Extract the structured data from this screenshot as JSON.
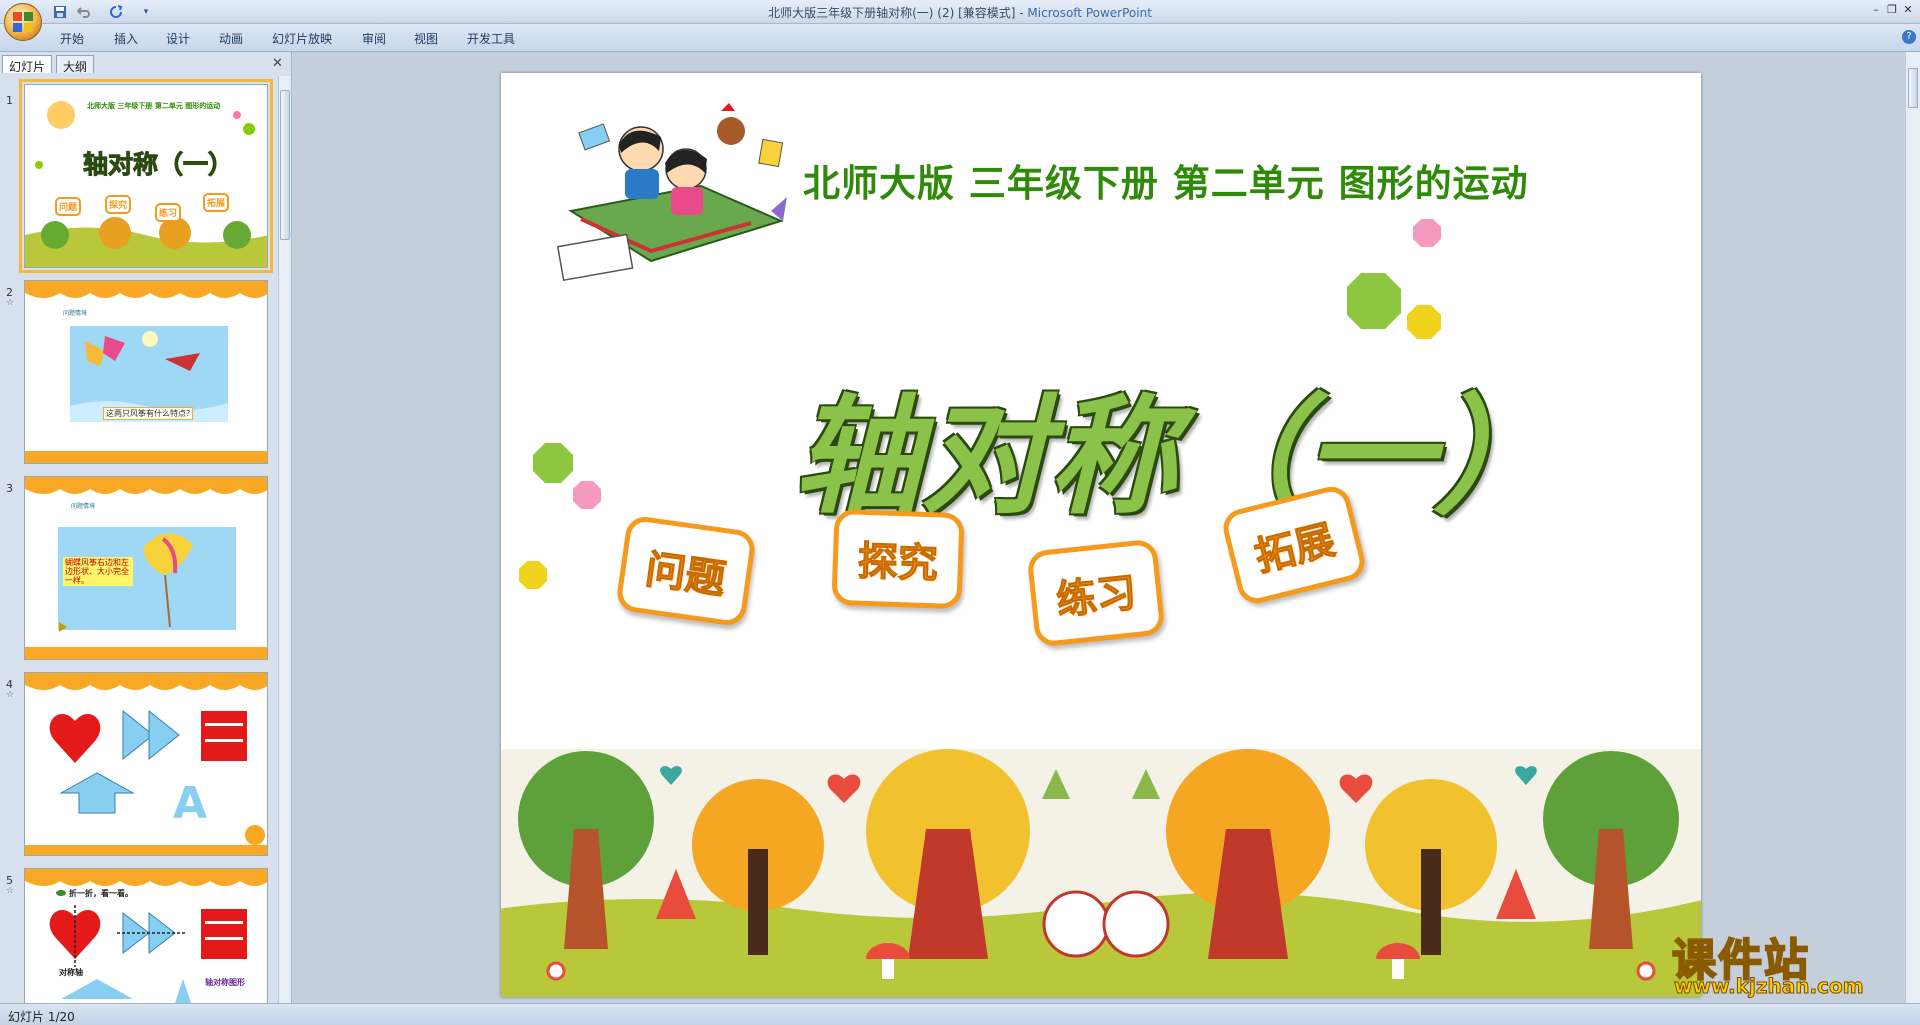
{
  "window": {
    "title": "北师大版三年级下册轴对称(一) (2) [兼容模式]",
    "app_name": "Microsoft PowerPoint",
    "title_separator": " - "
  },
  "qat": {
    "icons": [
      "save-icon",
      "undo-icon",
      "redo-icon",
      "customize-icon"
    ]
  },
  "ribbon": {
    "tabs": [
      {
        "label": "开始"
      },
      {
        "label": "插入"
      },
      {
        "label": "设计"
      },
      {
        "label": "动画"
      },
      {
        "label": "幻灯片放映"
      },
      {
        "label": "审阅"
      },
      {
        "label": "视图"
      },
      {
        "label": "开发工具"
      }
    ],
    "help_label": "?"
  },
  "panel": {
    "tabs": [
      {
        "label": "幻灯片"
      },
      {
        "label": "大纲"
      }
    ],
    "close_label": "✕",
    "thumbnails": [
      {
        "number": "1"
      },
      {
        "number": "2"
      },
      {
        "number": "3"
      },
      {
        "number": "4"
      },
      {
        "number": "5"
      }
    ],
    "selected_index": 0
  },
  "thumbs": {
    "t1_subtitle": "北师大版 三年级下册 第二单元 图形的运动",
    "t1_title": "轴对称（一）",
    "t1_badges": [
      "问题",
      "探究",
      "练习",
      "拓展"
    ],
    "t2_head": "问题情境",
    "t2_caption": "这两只风筝有什么特点?",
    "t3_head": "问题情境",
    "t3_caption": "蝴蝶风筝右边和左边形状、大小完全一样。",
    "t5_head": "折一折，看一看。",
    "t5_label_axis": "对称轴",
    "t5_label_figure": "轴对称图形"
  },
  "slide": {
    "subtitle": "北师大版  三年级下册  第二单元  图形的运动",
    "title": "轴对称（一）",
    "badges": [
      {
        "label": "问题"
      },
      {
        "label": "探究"
      },
      {
        "label": "练习"
      },
      {
        "label": "拓展"
      }
    ]
  },
  "colors": {
    "subtitle_green": "#2f8a0a",
    "title_green": "#8bc34a",
    "badge_orange": "#f59a1d",
    "selection": "#f4b740"
  },
  "watermark": {
    "text": "课件站",
    "url": "www.kjzhan.com"
  },
  "status": {
    "slide_counter": "幻灯片 1/20"
  }
}
